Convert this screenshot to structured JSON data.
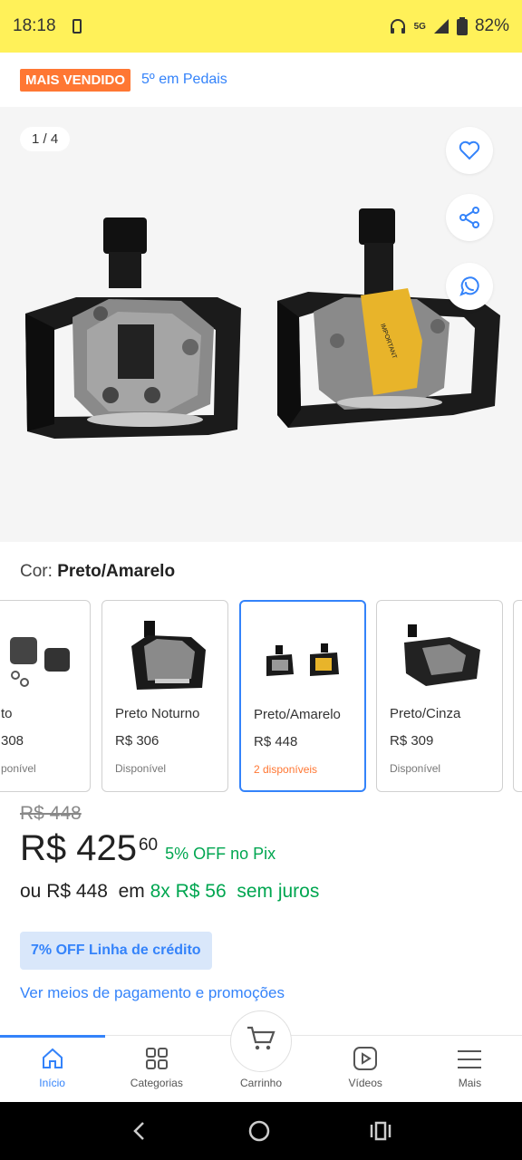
{
  "status_bar": {
    "time": "18:18",
    "battery": "82%",
    "network": "5G"
  },
  "product": {
    "badge": "MAIS VENDIDO",
    "ranking": "5º em Pedais",
    "image_counter": "1 / 4",
    "color_label": "Cor: ",
    "color_value": "Preto/Amarelo"
  },
  "variants": [
    {
      "name": "to",
      "price": "308",
      "stock": "ponível"
    },
    {
      "name": "Preto Noturno",
      "price": "R$ 306",
      "stock": "Disponível"
    },
    {
      "name": "Preto/Amarelo",
      "price": "R$ 448",
      "stock": "2 disponíveis"
    },
    {
      "name": "Preto/Cinza",
      "price": "R$ 309",
      "stock": "Disponível"
    }
  ],
  "pricing": {
    "old_price": "R$ 448",
    "price_main": "R$ 425",
    "price_cents": "60",
    "pix_discount": "5% OFF no Pix",
    "installment_prefix": "ou R$ 448  em ",
    "installment_highlight": "8x R$ 56  sem juros",
    "credit_badge": "7% OFF Linha de crédito",
    "payment_link": "Ver meios de pagamento e promoções"
  },
  "navbar": {
    "home": "Início",
    "categories": "Categorias",
    "cart": "Carrinho",
    "videos": "Vídeos",
    "more": "Mais"
  },
  "colors": {
    "brand_yellow": "#fff159",
    "accent_blue": "#3483fa",
    "green": "#00a650",
    "orange": "#ff7733"
  }
}
